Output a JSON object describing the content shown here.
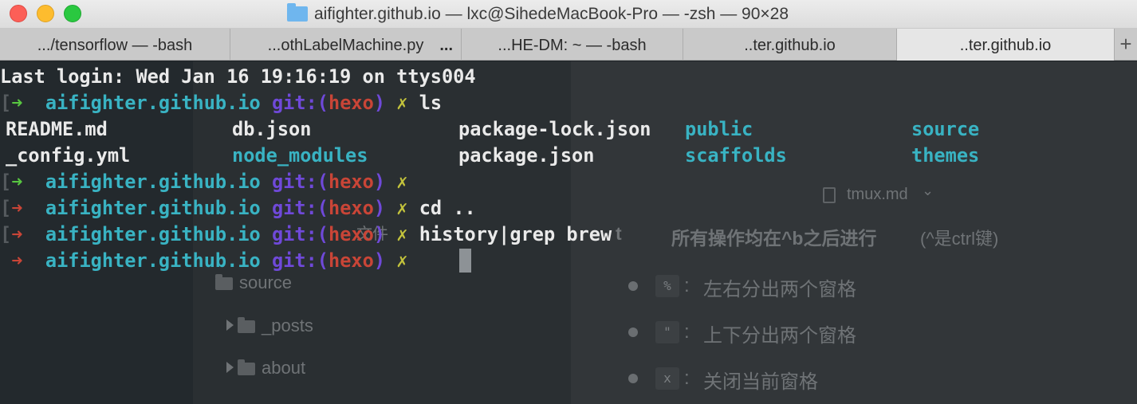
{
  "window": {
    "title": "aifighter.github.io — lxc@SihedeMacBook-Pro — -zsh — 90×28",
    "folder_icon": "folder-icon"
  },
  "tabs": [
    {
      "label": ".../tensorflow — -bash",
      "active": false
    },
    {
      "label": "...othLabelMachine.py",
      "active": false,
      "modified_marker": "..."
    },
    {
      "label": "...HE-DM: ~ — -bash",
      "active": false
    },
    {
      "label": "..ter.github.io",
      "active": false
    },
    {
      "label": "..ter.github.io",
      "active": true
    }
  ],
  "tab_add_label": "+",
  "terminal": {
    "last_login": "Last login: Wed Jan 16 19:16:19 on ttys004",
    "prompt": {
      "dir": "aifighter.github.io",
      "git_prefix": "git:(",
      "branch": "hexo",
      "git_suffix": ")",
      "dirty_marker": "✗",
      "bracket": "[",
      "arrow": "➜"
    },
    "commands": [
      "ls",
      "",
      "cd ..",
      "history|grep brew",
      ""
    ],
    "command_status": [
      "success",
      "success",
      "error",
      "error",
      "error"
    ],
    "ls_output": {
      "row1": [
        "README.md",
        "db.json",
        "package-lock.json",
        "public",
        "source"
      ],
      "row2": [
        "_config.yml",
        "node_modules",
        "package.json",
        "scaffolds",
        "themes"
      ]
    }
  },
  "background_editor": {
    "file_tab": "tmux.md",
    "tree_hint": "文件",
    "tree": [
      "source",
      "_posts",
      "about"
    ],
    "heading_prefix": "t",
    "heading_main": "所有操作均在^b之后进行",
    "heading_note": "(^是ctrl键)",
    "bullets": [
      {
        "key": "%",
        "text": "左右分出两个窗格"
      },
      {
        "key": "\"",
        "text": "上下分出两个窗格"
      },
      {
        "key": "x",
        "text": "关闭当前窗格"
      }
    ]
  },
  "colors": {
    "dir": "#39b3c3",
    "git": "#6f49d9",
    "branch": "#c94537",
    "arrow_success": "#58c641",
    "arrow_error": "#c94537",
    "dirty": "#c2c23c"
  }
}
